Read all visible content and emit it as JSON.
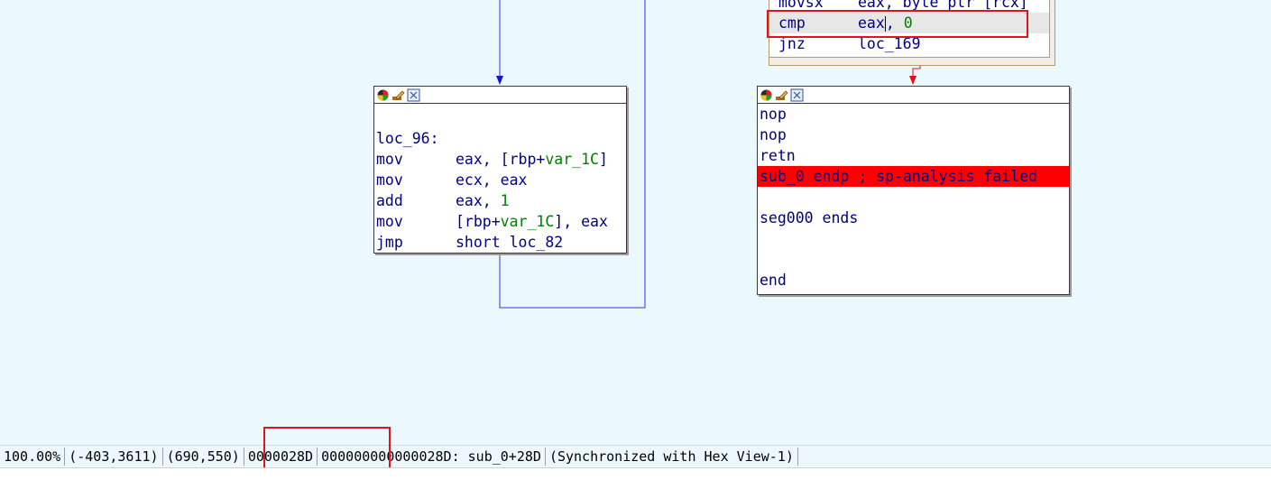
{
  "top_node": {
    "lines": [
      {
        "mn": "movsx",
        "ops": "eax, byte ptr [rcx]"
      },
      {
        "mn": "cmp",
        "ops_a": "eax",
        "ops_b": ", ",
        "ops_num": "0"
      },
      {
        "mn": "jnz",
        "ops": "loc_169"
      }
    ]
  },
  "left_node": {
    "label": "loc_96:",
    "lines": [
      {
        "mn": "mov",
        "pre": "eax, [rbp+",
        "var": "var_1C",
        "post": "]"
      },
      {
        "mn": "mov",
        "ops": "ecx, eax"
      },
      {
        "mn": "add",
        "pre": "eax, ",
        "num": "1"
      },
      {
        "mn": "mov",
        "pre": "[rbp+",
        "var": "var_1C",
        "post": "], eax"
      },
      {
        "mn": "jmp",
        "ops": "short loc_82"
      }
    ]
  },
  "right_node": {
    "lines": [
      "nop",
      "nop",
      "retn"
    ],
    "endp": "sub_0 endp ; sp-analysis failed",
    "seg_end": "seg000 ends",
    "end": "end"
  },
  "icons": [
    "color-palette-icon",
    "edit-name-icon",
    "graph-nodes-icon"
  ],
  "status": {
    "zoom": "100.00%",
    "mouse_coords": "(-403,3611)",
    "graph_coords": "(690,550)",
    "offset": "0000028D",
    "address": "000000000000028D: sub_0+28D",
    "sync": "(Synchronized with Hex View-1)"
  },
  "colors": {
    "background": "#ebf8fd",
    "edge_blue": "#3535e0",
    "edge_red": "#e01010",
    "highlight_red": "#ff0000",
    "annotation_red": "#e0141c"
  }
}
